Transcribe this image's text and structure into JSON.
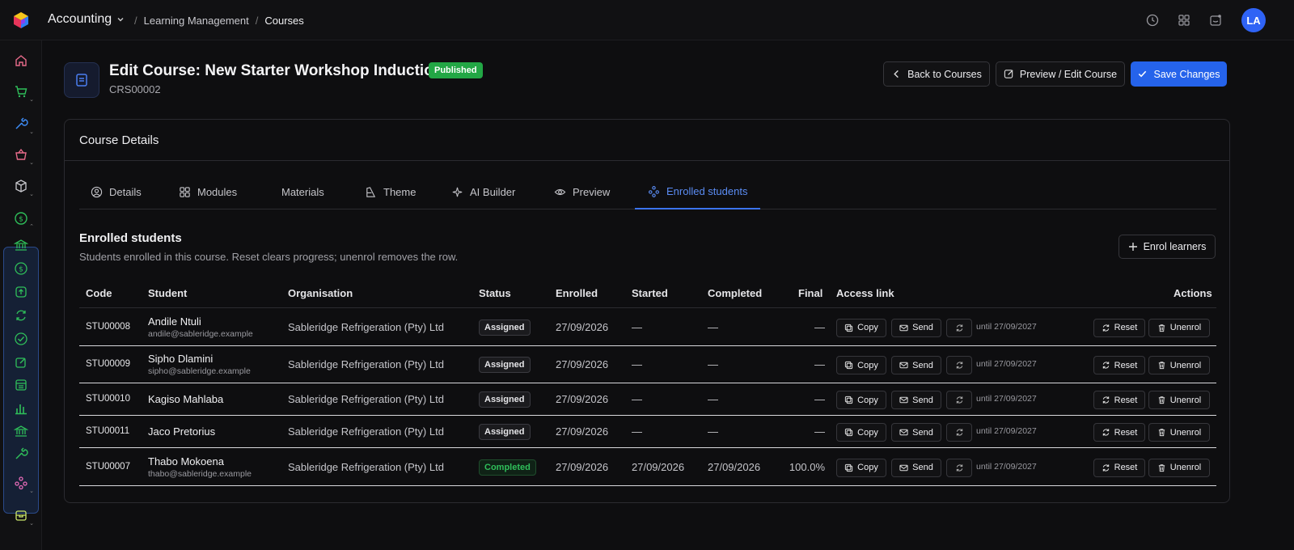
{
  "topbar": {
    "app_name": "Accounting",
    "breadcrumbs": [
      "Learning Management",
      "Courses"
    ],
    "separator": "/",
    "avatar_initials": "LA"
  },
  "colors": {
    "accent": "#2563eb",
    "published": "#22a745",
    "completed": "#2fbf5a"
  },
  "header": {
    "title": "Edit Course: New Starter Workshop Induction",
    "badge": "Published",
    "code": "CRS00002",
    "back_label": "Back to Courses",
    "preview_label": "Preview / Edit Course",
    "save_label": "Save Changes"
  },
  "card": {
    "title": "Course Details"
  },
  "tabs": [
    "Details",
    "Modules",
    "Materials",
    "Theme",
    "AI Builder",
    "Preview",
    "Enrolled students"
  ],
  "active_tab": "Enrolled students",
  "section": {
    "title": "Enrolled students",
    "description": "Students enrolled in this course. Reset clears progress; unenrol removes the row.",
    "enrol_label": "Enrol learners"
  },
  "table": {
    "headers": [
      "Code",
      "Student",
      "Organisation",
      "Status",
      "Enrolled",
      "Started",
      "Completed",
      "Final",
      "Access link",
      "Actions"
    ],
    "copy_label": "Copy",
    "send_label": "Send",
    "reset_label": "Reset",
    "unenrol_label": "Unenrol",
    "rows": [
      {
        "code": "STU00008",
        "name": "Andile Ntuli",
        "email": "andile@sableridge.example",
        "org": "Sableridge Refrigeration (Pty) Ltd",
        "status": "Assigned",
        "enrolled": "27/09/2026",
        "started": "—",
        "completed": "—",
        "final": "—",
        "until": "until 27/09/2027"
      },
      {
        "code": "STU00009",
        "name": "Sipho Dlamini",
        "email": "sipho@sableridge.example",
        "org": "Sableridge Refrigeration (Pty) Ltd",
        "status": "Assigned",
        "enrolled": "27/09/2026",
        "started": "—",
        "completed": "—",
        "final": "—",
        "until": "until 27/09/2027"
      },
      {
        "code": "STU00010",
        "name": "Kagiso Mahlaba",
        "email": "",
        "org": "Sableridge Refrigeration (Pty) Ltd",
        "status": "Assigned",
        "enrolled": "27/09/2026",
        "started": "—",
        "completed": "—",
        "final": "—",
        "until": "until 27/09/2027"
      },
      {
        "code": "STU00011",
        "name": "Jaco Pretorius",
        "email": "",
        "org": "Sableridge Refrigeration (Pty) Ltd",
        "status": "Assigned",
        "enrolled": "27/09/2026",
        "started": "—",
        "completed": "—",
        "final": "—",
        "until": "until 27/09/2027"
      },
      {
        "code": "STU00007",
        "name": "Thabo Mokoena",
        "email": "thabo@sableridge.example",
        "org": "Sableridge Refrigeration (Pty) Ltd",
        "status": "Completed",
        "enrolled": "27/09/2026",
        "started": "27/09/2026",
        "completed": "27/09/2026",
        "final": "100.0%",
        "until": "until 27/09/2027"
      }
    ]
  }
}
